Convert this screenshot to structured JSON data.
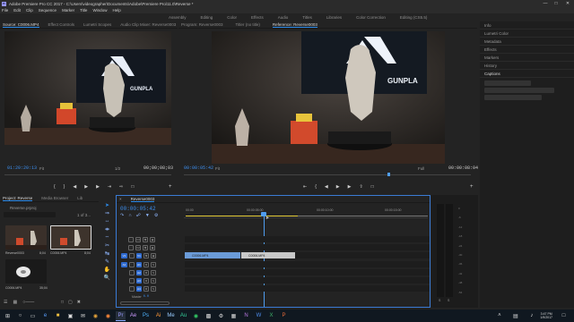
{
  "title_bar": {
    "app_badge": "Pr",
    "title": "Adobe Premiere Pro CC 2017 - C:\\Users\\videographer\\Documents\\Adobe\\Premiere Pro\\11.0\\Reverse *"
  },
  "menu": [
    "File",
    "Edit",
    "Clip",
    "Sequence",
    "Marker",
    "Title",
    "Window",
    "Help"
  ],
  "workspaces": [
    "Assembly",
    "Editing",
    "Color",
    "Effects",
    "Audio",
    "Titles",
    "Libraries",
    "Color Correction",
    "Editing (CS5.5)"
  ],
  "source_monitor": {
    "tabs": [
      "Source: C0006.MP4",
      "Effect Controls",
      "Lumetri Scopes",
      "Audio Clip Mixer: Reverse0003"
    ],
    "timecode": "01:20:20:13",
    "fit": "Fit",
    "scale": "1/2",
    "duration": "00;00;08;03",
    "video_text": "GUNPLA"
  },
  "program_monitor": {
    "tabs": [
      "Program: Reverse0003",
      "Titler (no title)",
      "Reference: Reverse0003"
    ],
    "timecode": "00:00:05:42",
    "fit": "Fit",
    "quality": "Full",
    "duration": "00:00:08:04",
    "video_text": "GUNPLA"
  },
  "right_panel": {
    "items": [
      "Info",
      "Lumetri Color",
      "Metadata",
      "Effects",
      "Markers",
      "History",
      "Captions"
    ],
    "active": "Captions"
  },
  "project": {
    "tabs": [
      "Project: Reverse",
      "Media Browser",
      "Lib"
    ],
    "file": "Reverse.prproj",
    "count": "1 of 3...",
    "items": [
      {
        "name": "Reverse0003",
        "duration": "8;04"
      },
      {
        "name": "C0006.MP4",
        "duration": "8;04"
      },
      {
        "name": "C0006.MP4",
        "duration": "35;04"
      }
    ]
  },
  "timeline": {
    "tab": "Reverse0003",
    "timecode": "00:00:05:42",
    "ruler": [
      "00:00",
      "00:00:05:00",
      "00:00:10:00",
      "00:00:15:00"
    ],
    "tracks": [
      {
        "id": "V3",
        "kind": "video"
      },
      {
        "id": "V2",
        "kind": "video"
      },
      {
        "id": "V1",
        "kind": "video"
      },
      {
        "id": "A1",
        "kind": "audio"
      },
      {
        "id": "A2",
        "kind": "audio"
      },
      {
        "id": "A3",
        "kind": "audio"
      },
      {
        "id": "A4",
        "kind": "audio"
      }
    ],
    "clips": [
      {
        "name": "C0006.MP4",
        "track": "V1",
        "color": "#6b9bd8"
      },
      {
        "name": "C0006.MP4",
        "track": "V1",
        "color": "#c9c9c9"
      }
    ],
    "master": "Master",
    "master_value": "0.0"
  },
  "meters": {
    "scale": [
      "0",
      "-6",
      "-12",
      "-18",
      "-24",
      "-30",
      "-36",
      "-42",
      "-48",
      "-54"
    ],
    "labels": [
      "S",
      "S"
    ]
  },
  "taskbar": {
    "time": "3:47 PM",
    "date": "1/9/2017"
  },
  "colors": {
    "accent": "#2d8ceb",
    "timecode": "#3c8ff0",
    "playhead": "#4f9df0"
  }
}
